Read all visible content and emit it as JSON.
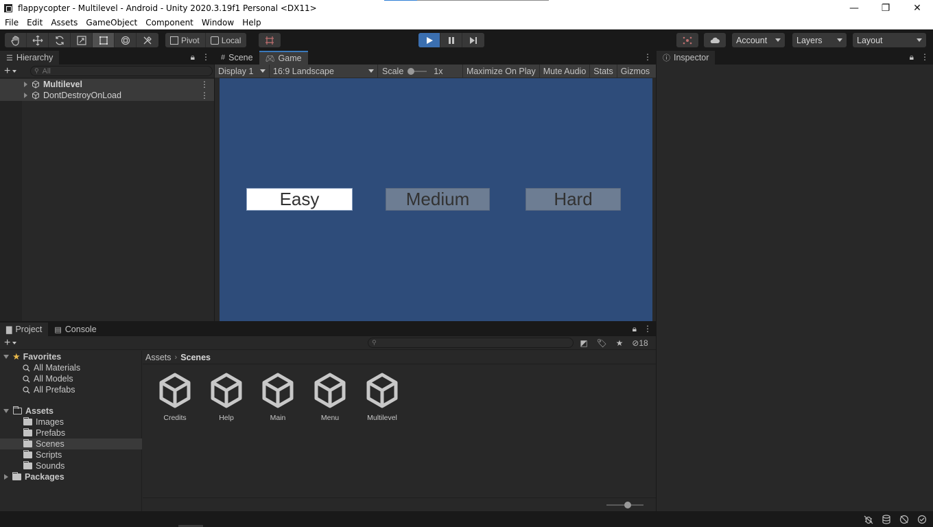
{
  "window": {
    "title": "flappycopter - Multilevel - Android - Unity 2020.3.19f1 Personal <DX11>",
    "minimize_glyph": "—",
    "maximize_glyph": "❐",
    "close_glyph": "✕"
  },
  "menu": {
    "items": [
      "File",
      "Edit",
      "Assets",
      "GameObject",
      "Component",
      "Window",
      "Help"
    ]
  },
  "toolbar": {
    "pivot_label": "Pivot",
    "local_label": "Local",
    "account_label": "Account",
    "layers_label": "Layers",
    "layout_label": "Layout",
    "play_active": true,
    "accent_color": "#3b6fb0"
  },
  "hierarchy": {
    "tab_label": "Hierarchy",
    "search_placeholder": "All",
    "items": [
      {
        "label": "Multilevel",
        "bold": true
      },
      {
        "label": "DontDestroyOnLoad",
        "bold": false
      }
    ]
  },
  "scene_tab": {
    "label": "Scene"
  },
  "game": {
    "tab_label": "Game",
    "display": "Display 1",
    "aspect": "16:9 Landscape",
    "scale_label": "Scale",
    "scale_value": "1x",
    "maximize_label": "Maximize On Play",
    "mute_label": "Mute Audio",
    "stats_label": "Stats",
    "gizmos_label": "Gizmos",
    "background_color": "#2e4c7a",
    "buttons": [
      {
        "label": "Easy",
        "selected": true
      },
      {
        "label": "Medium",
        "selected": false
      },
      {
        "label": "Hard",
        "selected": false
      }
    ]
  },
  "inspector": {
    "tab_label": "Inspector"
  },
  "project": {
    "tab_label": "Project",
    "console_label": "Console",
    "hidden_count": "18",
    "favorites": {
      "label": "Favorites",
      "items": [
        "All Materials",
        "All Models",
        "All Prefabs"
      ]
    },
    "assets": {
      "label": "Assets",
      "items": [
        "Images",
        "Prefabs",
        "Scenes",
        "Scripts",
        "Sounds"
      ],
      "selected": "Scenes"
    },
    "packages_label": "Packages",
    "breadcrumb": {
      "root": "Assets",
      "current": "Scenes"
    },
    "scene_files": [
      "Credits",
      "Help",
      "Main",
      "Menu",
      "Multilevel"
    ]
  }
}
